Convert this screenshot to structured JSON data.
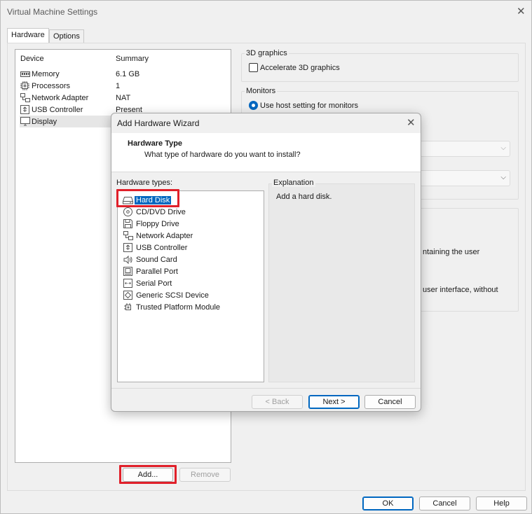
{
  "window": {
    "title": "Virtual Machine Settings",
    "tabs": [
      {
        "label": "Hardware",
        "active": true
      },
      {
        "label": "Options",
        "active": false
      }
    ]
  },
  "device_list": {
    "col_device": "Device",
    "col_summary": "Summary",
    "items": [
      {
        "icon": "memory-icon",
        "name": "Memory",
        "summary": "6.1 GB"
      },
      {
        "icon": "processor-icon",
        "name": "Processors",
        "summary": "1"
      },
      {
        "icon": "network-adapter-icon",
        "name": "Network Adapter",
        "summary": "NAT"
      },
      {
        "icon": "usb-icon",
        "name": "USB Controller",
        "summary": "Present"
      },
      {
        "icon": "display-icon",
        "name": "Display",
        "summary": ""
      }
    ],
    "add_label": "Add...",
    "remove_label": "Remove"
  },
  "right_panel": {
    "graphics_title": "3D graphics",
    "accelerate_label": "Accelerate 3D graphics",
    "accelerate_checked": false,
    "monitors_title": "Monitors",
    "host_setting_label": "Use host setting for monitors",
    "partial_text_1": "ntaining the user",
    "partial_text_2": "user interface, without"
  },
  "footer": {
    "ok_label": "OK",
    "cancel_label": "Cancel",
    "help_label": "Help"
  },
  "wizard": {
    "title": "Add Hardware Wizard",
    "header_title": "Hardware Type",
    "header_subtitle": "What type of hardware do you want to install?",
    "types_label": "Hardware types:",
    "hardware_types": [
      {
        "icon": "hard-disk-icon",
        "label": "Hard Disk",
        "selected": true
      },
      {
        "icon": "cd-dvd-icon",
        "label": "CD/DVD Drive",
        "selected": false
      },
      {
        "icon": "floppy-icon",
        "label": "Floppy Drive",
        "selected": false
      },
      {
        "icon": "network-adapter-icon",
        "label": "Network Adapter",
        "selected": false
      },
      {
        "icon": "usb-icon",
        "label": "USB Controller",
        "selected": false
      },
      {
        "icon": "sound-icon",
        "label": "Sound Card",
        "selected": false
      },
      {
        "icon": "parallel-port-icon",
        "label": "Parallel Port",
        "selected": false
      },
      {
        "icon": "serial-port-icon",
        "label": "Serial Port",
        "selected": false
      },
      {
        "icon": "scsi-icon",
        "label": "Generic SCSI Device",
        "selected": false
      },
      {
        "icon": "tpm-icon",
        "label": "Trusted Platform Module",
        "selected": false
      }
    ],
    "explanation_title": "Explanation",
    "explanation_text": "Add a hard disk.",
    "back_label": "< Back",
    "next_label": "Next >",
    "cancel_label": "Cancel"
  },
  "colors": {
    "accent": "#0067c0",
    "highlight_annotation": "#e0202a"
  }
}
